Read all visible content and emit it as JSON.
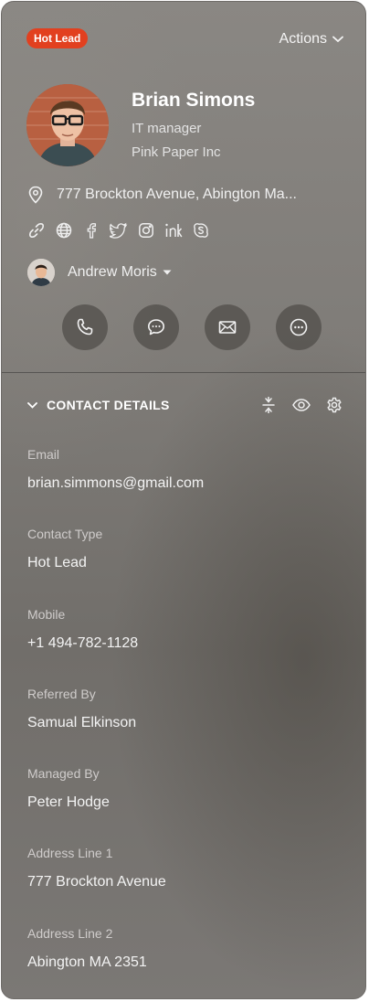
{
  "header": {
    "badge": "Hot Lead",
    "actions_label": "Actions"
  },
  "profile": {
    "name": "Brian Simons",
    "title": "IT manager",
    "company": "Pink Paper Inc",
    "address": "777 Brockton Avenue, Abington Ma..."
  },
  "social_icons": [
    "link-icon",
    "globe-icon",
    "facebook-icon",
    "twitter-icon",
    "instagram-icon",
    "linkedin-icon",
    "skype-icon"
  ],
  "owner": {
    "name": "Andrew Moris"
  },
  "comm_buttons": [
    "phone-icon",
    "message-icon",
    "mail-icon",
    "more-icon"
  ],
  "contact_details": {
    "section_title": "CONTACT DETAILS",
    "fields": [
      {
        "label": "Email",
        "value": "brian.simmons@gmail.com"
      },
      {
        "label": "Contact Type",
        "value": "Hot Lead"
      },
      {
        "label": "Mobile",
        "value": "+1 494-782-1128"
      },
      {
        "label": "Referred By",
        "value": "Samual Elkinson"
      },
      {
        "label": "Managed By",
        "value": "Peter Hodge"
      },
      {
        "label": "Address Line 1",
        "value": "777 Brockton Avenue"
      },
      {
        "label": "Address Line 2",
        "value": "Abington MA 2351"
      }
    ]
  },
  "colors": {
    "badge": "#e2401f",
    "panel": "#7f7c78"
  }
}
